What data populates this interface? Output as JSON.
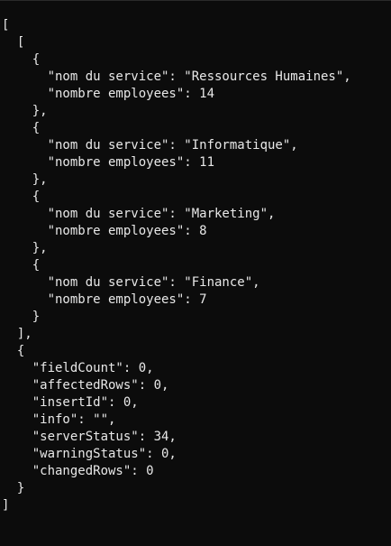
{
  "console": {
    "lines": [
      "[",
      "  [",
      "    {",
      "      \"nom du service\": \"Ressources Humaines\",",
      "      \"nombre employees\": 14",
      "    },",
      "    {",
      "      \"nom du service\": \"Informatique\",",
      "      \"nombre employees\": 11",
      "    },",
      "    {",
      "      \"nom du service\": \"Marketing\",",
      "      \"nombre employees\": 8",
      "    },",
      "    {",
      "      \"nom du service\": \"Finance\",",
      "      \"nombre employees\": 7",
      "    }",
      "  ],",
      "  {",
      "    \"fieldCount\": 0,",
      "    \"affectedRows\": 0,",
      "    \"insertId\": 0,",
      "    \"info\": \"\",",
      "    \"serverStatus\": 34,",
      "    \"warningStatus\": 0,",
      "    \"changedRows\": 0",
      "  }",
      "]"
    ]
  }
}
